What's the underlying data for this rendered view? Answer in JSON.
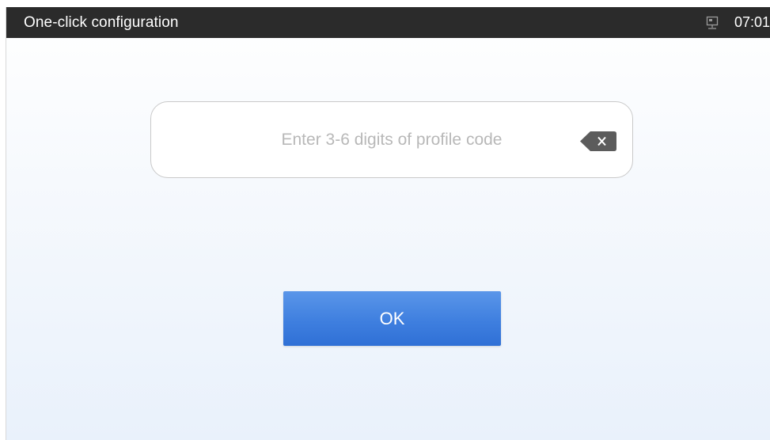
{
  "status_bar": {
    "title": "One-click configuration",
    "time": "07:01",
    "network_icon": "ethernet-icon"
  },
  "code_field": {
    "placeholder": "Enter 3-6 digits of profile code",
    "value": "",
    "clear_icon": "backspace-icon"
  },
  "ok_button": {
    "label": "OK"
  },
  "colors": {
    "status_bar_bg": "#2b2b2b",
    "button_blue": "#3f7fdf",
    "placeholder_gray": "#b8b8b8"
  }
}
